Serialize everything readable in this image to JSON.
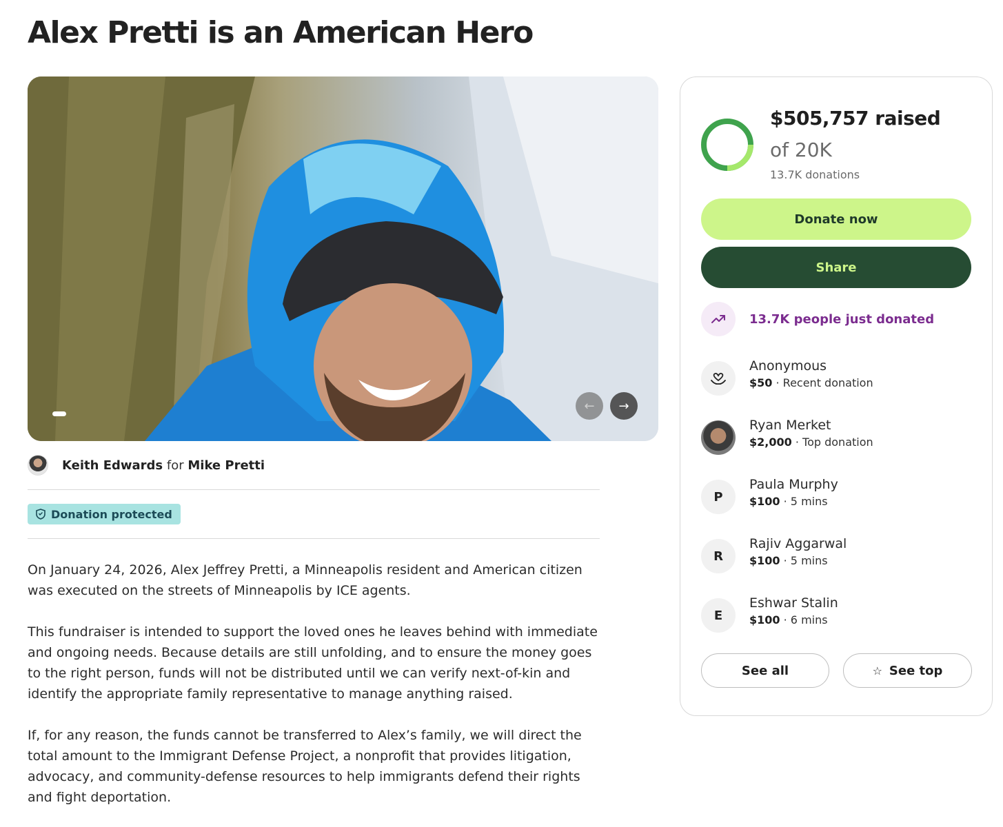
{
  "page": {
    "title": "Alex Pretti is an American Hero"
  },
  "organizer": {
    "name": "Keith Edwards",
    "connector": "for",
    "beneficiary": "Mike Pretti"
  },
  "badge": {
    "label": "Donation protected"
  },
  "story": {
    "paragraphs": [
      "On January 24, 2026, Alex Jeffrey Pretti, a Minneapolis resident and American citizen was executed on the streets of Minneapolis by ICE agents.",
      "This fundraiser is intended to support the loved ones he leaves behind with immediate and ongoing needs. Because details are still unfolding, and to ensure the money goes to the right person, funds will not be distributed until we can verify next-of-kin and identify the appropriate family representative to manage anything raised.",
      "If, for any reason, the funds cannot be transferred to Alex’s family, we will direct the total amount to the Immigrant Defense Project, a nonprofit that provides litigation, advocacy, and community-defense resources to help immigrants defend their rights and fight deportation."
    ]
  },
  "carousel": {
    "prev_icon": "arrow-left-icon",
    "next_icon": "arrow-right-icon"
  },
  "summary": {
    "raised_label": "$505,757 raised",
    "goal_label": "of 20K",
    "donations_label": "13.7K donations",
    "progress_fraction": 1.0,
    "ring_colors": [
      "#3fa34d",
      "#a5e86b"
    ]
  },
  "buttons": {
    "donate": "Donate now",
    "share": "Share",
    "see_all": "See all",
    "see_top": "See top"
  },
  "trend": {
    "label": "13.7K people just donated",
    "icon": "trending-up-icon"
  },
  "donors": [
    {
      "initial": "",
      "name": "Anonymous",
      "amount": "$50",
      "detail": "Recent donation",
      "avatar": "heart-hand-icon"
    },
    {
      "initial": "",
      "name": "Ryan Merket",
      "amount": "$2,000",
      "detail": "Top donation",
      "avatar": "photo"
    },
    {
      "initial": "P",
      "name": "Paula Murphy",
      "amount": "$100",
      "detail": "5 mins",
      "avatar": "initial"
    },
    {
      "initial": "R",
      "name": "Rajiv Aggarwal",
      "amount": "$100",
      "detail": "5 mins",
      "avatar": "initial"
    },
    {
      "initial": "E",
      "name": "Eshwar Stalin",
      "amount": "$100",
      "detail": "6 mins",
      "avatar": "initial"
    }
  ],
  "colors": {
    "accent_green": "#cdf58a",
    "dark_green": "#264c33",
    "purple": "#7b2c8f",
    "badge_teal": "#a8e3e1"
  }
}
